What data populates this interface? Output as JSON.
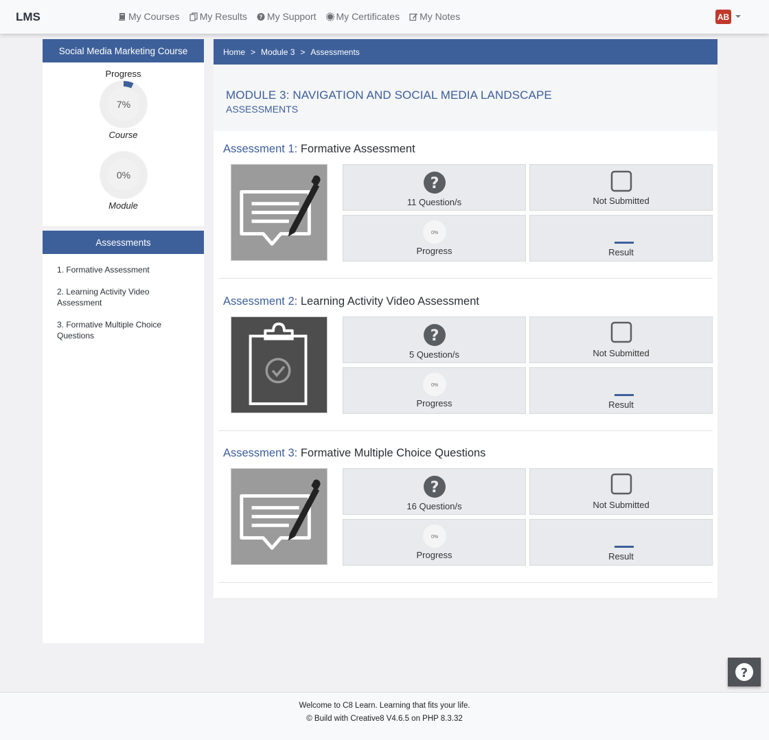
{
  "app": {
    "brand": "LMS"
  },
  "nav": {
    "items": [
      {
        "label": "My Courses",
        "icon": "book-icon"
      },
      {
        "label": "My Results",
        "icon": "files-icon"
      },
      {
        "label": "My Support",
        "icon": "question-circle-icon"
      },
      {
        "label": "My Certificates",
        "icon": "certificate-icon"
      },
      {
        "label": "My Notes",
        "icon": "edit-icon"
      }
    ],
    "avatar_initials": "AB"
  },
  "sidebar": {
    "course_title": "Social Media Marketing Course",
    "progress_label": "Progress",
    "course_progress": {
      "value": 7,
      "text": "7%",
      "label": "Course"
    },
    "module_progress": {
      "value": 0,
      "text": "0%",
      "label": "Module"
    },
    "assessments_header": "Assessments",
    "assessments": [
      "1. Formative Assessment",
      "2. Learning Activity Video Assessment",
      "3. Formative Multiple Choice Questions"
    ]
  },
  "breadcrumb": {
    "items": [
      "Home",
      "Module 3",
      "Assessments"
    ],
    "separator": ">"
  },
  "module": {
    "title": "MODULE 3: NAVIGATION AND SOCIAL MEDIA LANDSCAPE",
    "subtitle": "ASSESSMENTS"
  },
  "assessments": [
    {
      "number_label": "Assessment 1:",
      "name": "Formative Assessment",
      "thumb": "pencil-paper-icon",
      "questions": "11 Question/s",
      "status": "Not Submitted",
      "progress_text": "0%",
      "progress_label": "Progress",
      "result_label": "Result"
    },
    {
      "number_label": "Assessment 2:",
      "name": "Learning Activity Video Assessment",
      "thumb": "clipboard-check-icon",
      "questions": "5 Question/s",
      "status": "Not Submitted",
      "progress_text": "0%",
      "progress_label": "Progress",
      "result_label": "Result"
    },
    {
      "number_label": "Assessment 3:",
      "name": "Formative Multiple Choice Questions",
      "thumb": "pencil-paper-icon",
      "questions": "16 Question/s",
      "status": "Not Submitted",
      "progress_text": "0%",
      "progress_label": "Progress",
      "result_label": "Result"
    }
  ],
  "footer": {
    "line1": "Welcome to C8 Learn. Learning that fits your life.",
    "line2": "© Build with Creative8 V4.6.5 on PHP 8.3.32"
  },
  "colors": {
    "primary": "#3e609a",
    "avatar": "#c0392b",
    "tile": "#e8eaed"
  }
}
